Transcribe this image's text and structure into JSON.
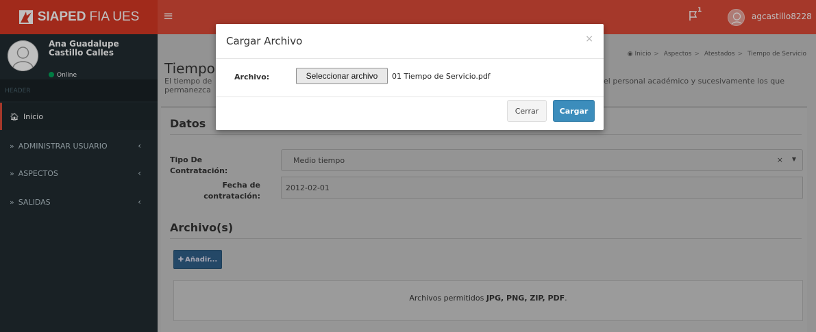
{
  "brand": {
    "bold": "SIAPED",
    "rest": "FIA UES",
    "accent": "#dd4b39"
  },
  "topbar": {
    "menu_icon": "hamburger-icon",
    "flag_icon": "flag-icon",
    "flag_count": "1",
    "username": "agcastillo8228"
  },
  "sidebar": {
    "user_name": "Ana Guadalupe Castillo Calles",
    "status": "Online",
    "header_label": "HEADER",
    "items": [
      {
        "label": "Inicio",
        "icon": "home-icon"
      },
      {
        "label": "ADMINISTRAR USUARIO",
        "icon": "double-chevron-icon"
      },
      {
        "label": "ASPECTOS",
        "icon": "double-chevron-icon"
      },
      {
        "label": "SALIDAS",
        "icon": "double-chevron-icon"
      }
    ]
  },
  "breadcrumb": [
    "Inicio",
    "Aspectos",
    "Atestados",
    "Tiempo de Servicio"
  ],
  "page": {
    "title": "Tiempo",
    "desc_left_1": "El tiempo de",
    "desc_left_2": "permanezca",
    "desc_right": "el personal académico y sucesivamente los que"
  },
  "datos": {
    "heading": "Datos",
    "tipo_label": "Tipo De Contratación:",
    "tipo_value": "Medio tiempo",
    "fecha_label_1": "Fecha de",
    "fecha_label_2": "contratación:",
    "fecha_value": "2012-02-01"
  },
  "archivos": {
    "heading": "Archivo(s)",
    "add_label": "Añadir...",
    "allowed_prefix": "Archivos permitidos ",
    "allowed_types": "JPG, PNG, ZIP, PDF",
    "allowed_suffix": "."
  },
  "modal": {
    "title": "Cargar Archivo",
    "close": "×",
    "file_label": "Archivo:",
    "file_button": "Seleccionar archivo",
    "file_name": "01 Tiempo de Servicio.pdf",
    "cancel": "Cerrar",
    "submit": "Cargar"
  }
}
